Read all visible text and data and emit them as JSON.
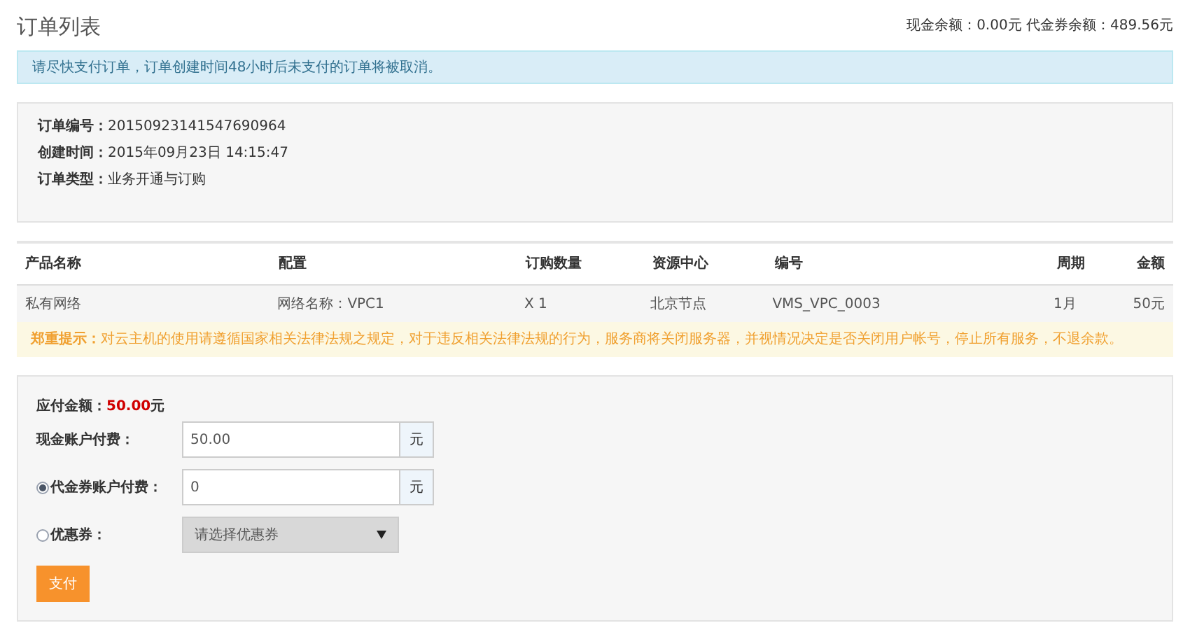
{
  "page_title": "订单列表",
  "balances": "现金余额：0.00元 代金券余额：489.56元",
  "alert": "请尽快支付订单，订单创建时间48小时后未支付的订单将被取消。",
  "order_info": [
    {
      "label": "订单编号：",
      "value": "20150923141547690964"
    },
    {
      "label": "创建时间：",
      "value": "2015年09月23日 14:15:47"
    },
    {
      "label": "订单类型：",
      "value": "业务开通与订购"
    }
  ],
  "table": {
    "columns": [
      "产品名称",
      "配置",
      "订购数量",
      "资源中心",
      "编号",
      "周期",
      "金额"
    ],
    "rows": [
      [
        "私有网络",
        "网络名称：VPC1",
        "X 1",
        "北京节点",
        "VMS_VPC_0003",
        "1月",
        "50元"
      ]
    ]
  },
  "notice": "**郑重提示：**对云主机的使用请遵循国家相关法律法规之规定，对于违反相关法律法规的行为，服务商将关闭服务器，并视情况决定是否关闭用户帐号，停止所有服务，不退余款。",
  "payment": {
    "amount_due": "应付金额：**50.00**元",
    "rows": [
      {
        "kind": "input",
        "label": "现金账户付费：",
        "value": "50.00",
        "unit": "元"
      },
      {
        "kind": "input",
        "label": "代金券账户付费：",
        "value": "0",
        "unit": "元",
        "selected": true
      },
      {
        "kind": "select",
        "label": "优惠券：",
        "placeholder": "请选择优惠券",
        "selected": false
      }
    ],
    "submit": "支付"
  }
}
